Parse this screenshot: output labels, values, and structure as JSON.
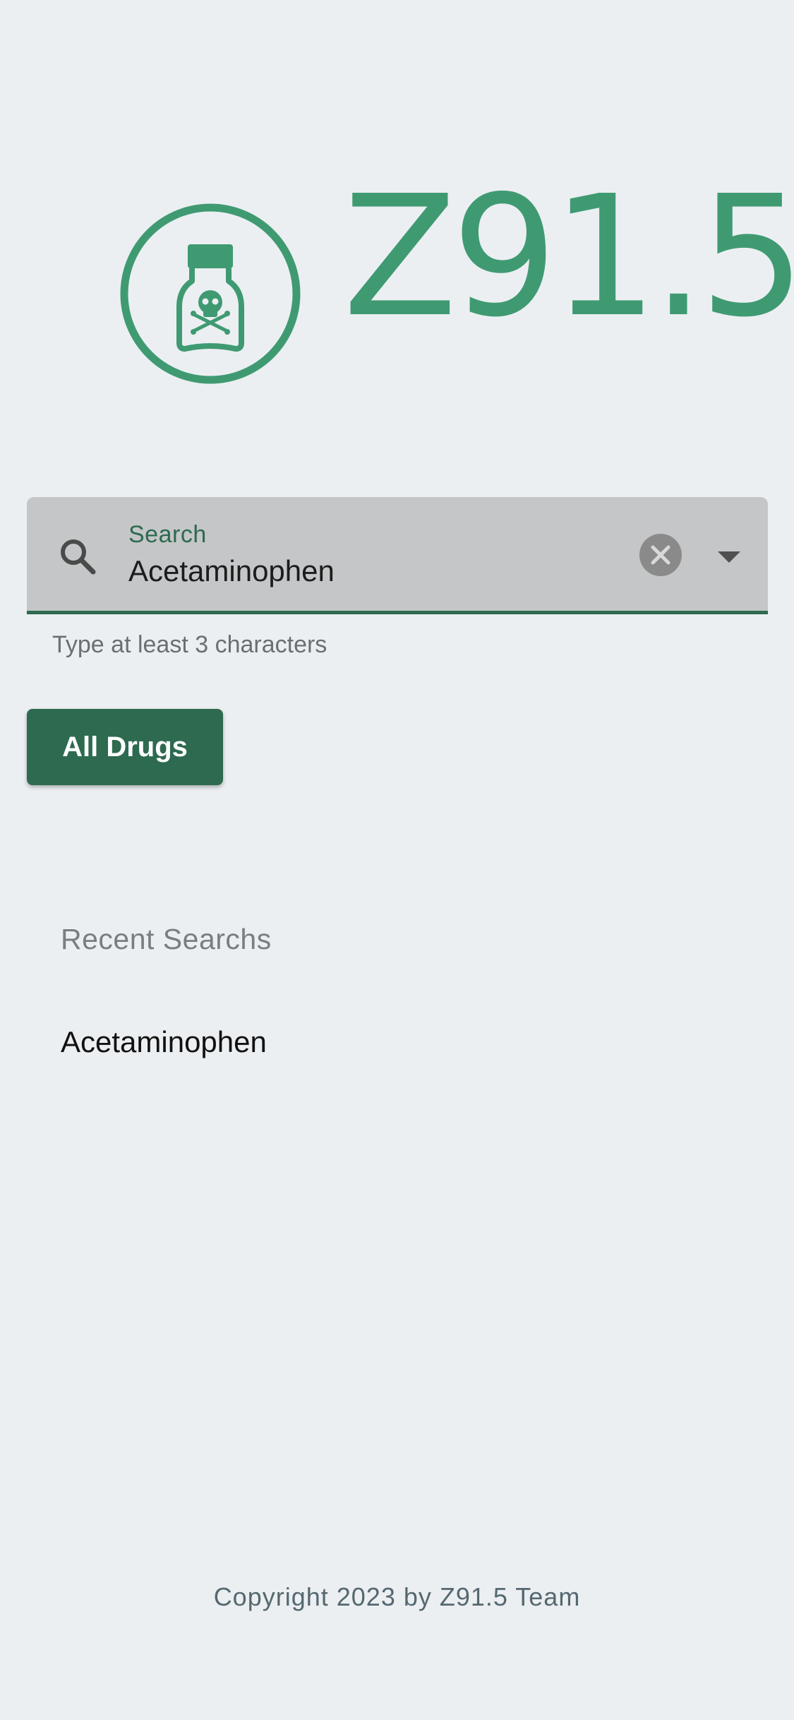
{
  "app": {
    "name": "Z91.5",
    "logo_icon": "poison-bottle-icon"
  },
  "colors": {
    "brand": "#3f9a72",
    "accent_dark": "#2d6a4f",
    "background": "#ebeff2",
    "field_background": "#c4c6c7"
  },
  "search": {
    "label": "Search",
    "value": "Acetaminophen",
    "helper": "Type at least 3 characters",
    "icons": {
      "leading": "search-icon",
      "clear": "clear-icon",
      "dropdown": "dropdown-arrow-icon"
    }
  },
  "actions": {
    "all_drugs_label": "All Drugs"
  },
  "recent": {
    "title": "Recent Searchs",
    "items": [
      "Acetaminophen"
    ]
  },
  "footer": {
    "text": "Copyright 2023 by Z91.5 Team"
  }
}
